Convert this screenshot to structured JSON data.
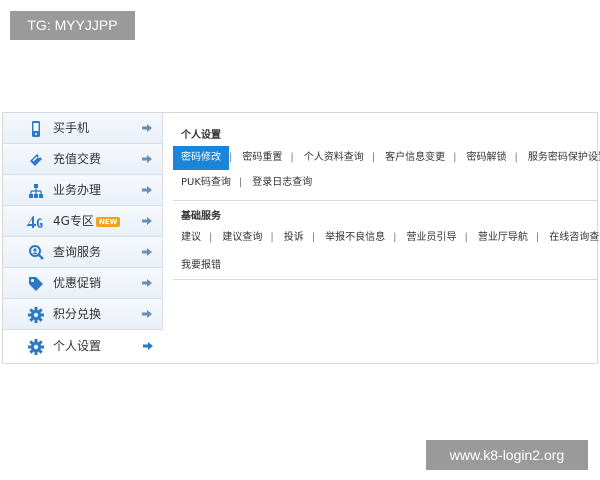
{
  "watermarks": {
    "top": "TG: MYYJJPP",
    "bottom": "www.k8-login2.org"
  },
  "sidebar": {
    "items": [
      {
        "label": "买手机",
        "icon": "mobile-phone-icon",
        "active": false
      },
      {
        "label": "充值交费",
        "icon": "recharge-card-icon",
        "active": false
      },
      {
        "label": "业务办理",
        "icon": "network-icon",
        "active": false
      },
      {
        "label": "4G专区",
        "icon": "4g-icon",
        "badge": "NEW",
        "active": false
      },
      {
        "label": "查询服务",
        "icon": "search-user-icon",
        "active": false
      },
      {
        "label": "优惠促销",
        "icon": "tag-icon",
        "active": false
      },
      {
        "label": "积分兑换",
        "icon": "gear-icon",
        "active": false
      },
      {
        "label": "个人设置",
        "icon": "gear-icon",
        "active": true
      }
    ]
  },
  "content": {
    "sections": [
      {
        "title": "个人设置",
        "rows": [
          [
            "密码修改",
            "密码重置",
            "个人资料查询",
            "客户信息变更",
            "密码解锁",
            "服务密码保护设置"
          ],
          [
            "PUK码查询",
            "登录日志查询"
          ]
        ],
        "active": "密码修改"
      },
      {
        "title": "基础服务",
        "rows": [
          [
            "建议",
            "建议查询",
            "投诉",
            "举报不良信息",
            "营业员引导",
            "营业厅导航",
            "在线咨询查询"
          ],
          [
            "我要报错"
          ]
        ]
      }
    ]
  },
  "colors": {
    "accent": "#1b86d8",
    "icon_blue": "#2a78c6",
    "badge": "#f0a21a"
  }
}
